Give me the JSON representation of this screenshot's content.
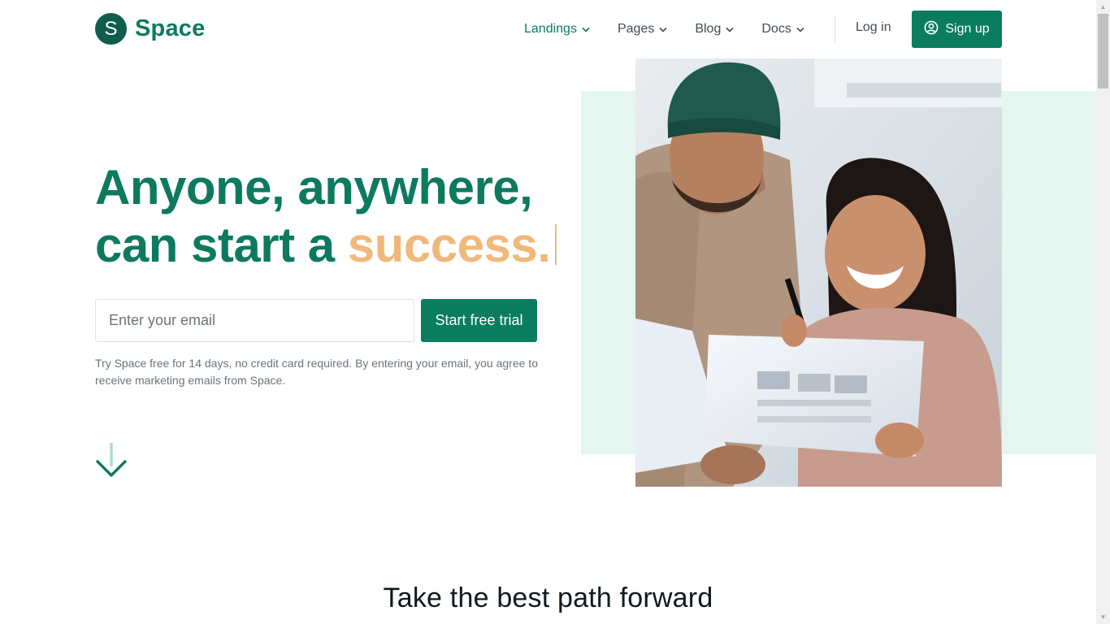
{
  "header": {
    "logo_letter": "S",
    "brand_name": "Space",
    "nav": [
      {
        "label": "Landings",
        "active": true
      },
      {
        "label": "Pages",
        "active": false
      },
      {
        "label": "Blog",
        "active": false
      },
      {
        "label": "Docs",
        "active": false
      }
    ],
    "login_label": "Log in",
    "signup_label": "Sign up"
  },
  "hero": {
    "title_line1": "Anyone, anywhere,",
    "title_line2_prefix": "can start a ",
    "title_line2_accent": "success.",
    "email_placeholder": "Enter your email",
    "cta_label": "Start free trial",
    "disclaimer": "Try Space free for 14 days, no credit card required. By entering your email, you agree to receive marketing emails from Space."
  },
  "section": {
    "title": "Take the best path forward"
  },
  "colors": {
    "brand": "#0d7a5f",
    "button": "#0a7d5e",
    "accent": "#f0b87a",
    "mint": "#e5f6f1"
  },
  "icons": {
    "chevron": "chevron-down-icon",
    "user": "user-circle-icon",
    "scroll": "arrow-down-icon"
  }
}
